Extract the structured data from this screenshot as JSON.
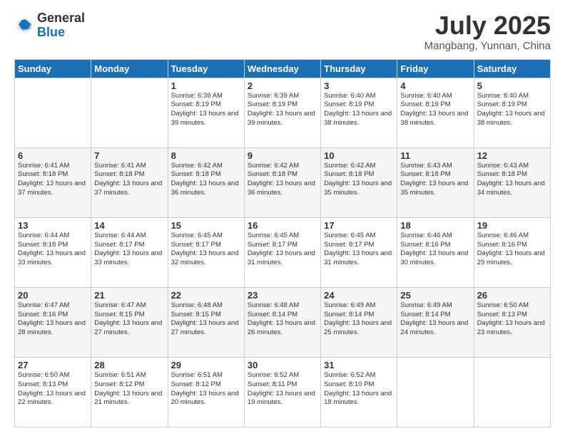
{
  "header": {
    "logo": {
      "general": "General",
      "blue": "Blue"
    },
    "title": "July 2025",
    "subtitle": "Mangbang, Yunnan, China"
  },
  "days_of_week": [
    "Sunday",
    "Monday",
    "Tuesday",
    "Wednesday",
    "Thursday",
    "Friday",
    "Saturday"
  ],
  "weeks": [
    [
      {
        "day": "",
        "info": ""
      },
      {
        "day": "",
        "info": ""
      },
      {
        "day": "1",
        "info": "Sunrise: 6:39 AM\nSunset: 8:19 PM\nDaylight: 13 hours and 39 minutes."
      },
      {
        "day": "2",
        "info": "Sunrise: 6:39 AM\nSunset: 8:19 PM\nDaylight: 13 hours and 39 minutes."
      },
      {
        "day": "3",
        "info": "Sunrise: 6:40 AM\nSunset: 8:19 PM\nDaylight: 13 hours and 38 minutes."
      },
      {
        "day": "4",
        "info": "Sunrise: 6:40 AM\nSunset: 8:19 PM\nDaylight: 13 hours and 38 minutes."
      },
      {
        "day": "5",
        "info": "Sunrise: 6:40 AM\nSunset: 8:19 PM\nDaylight: 13 hours and 38 minutes."
      }
    ],
    [
      {
        "day": "6",
        "info": "Sunrise: 6:41 AM\nSunset: 8:18 PM\nDaylight: 13 hours and 37 minutes."
      },
      {
        "day": "7",
        "info": "Sunrise: 6:41 AM\nSunset: 8:18 PM\nDaylight: 13 hours and 37 minutes."
      },
      {
        "day": "8",
        "info": "Sunrise: 6:42 AM\nSunset: 8:18 PM\nDaylight: 13 hours and 36 minutes."
      },
      {
        "day": "9",
        "info": "Sunrise: 6:42 AM\nSunset: 8:18 PM\nDaylight: 13 hours and 36 minutes."
      },
      {
        "day": "10",
        "info": "Sunrise: 6:42 AM\nSunset: 8:18 PM\nDaylight: 13 hours and 35 minutes."
      },
      {
        "day": "11",
        "info": "Sunrise: 6:43 AM\nSunset: 8:18 PM\nDaylight: 13 hours and 35 minutes."
      },
      {
        "day": "12",
        "info": "Sunrise: 6:43 AM\nSunset: 8:18 PM\nDaylight: 13 hours and 34 minutes."
      }
    ],
    [
      {
        "day": "13",
        "info": "Sunrise: 6:44 AM\nSunset: 8:18 PM\nDaylight: 13 hours and 33 minutes."
      },
      {
        "day": "14",
        "info": "Sunrise: 6:44 AM\nSunset: 8:17 PM\nDaylight: 13 hours and 33 minutes."
      },
      {
        "day": "15",
        "info": "Sunrise: 6:45 AM\nSunset: 8:17 PM\nDaylight: 13 hours and 32 minutes."
      },
      {
        "day": "16",
        "info": "Sunrise: 6:45 AM\nSunset: 8:17 PM\nDaylight: 13 hours and 31 minutes."
      },
      {
        "day": "17",
        "info": "Sunrise: 6:45 AM\nSunset: 8:17 PM\nDaylight: 13 hours and 31 minutes."
      },
      {
        "day": "18",
        "info": "Sunrise: 6:46 AM\nSunset: 8:16 PM\nDaylight: 13 hours and 30 minutes."
      },
      {
        "day": "19",
        "info": "Sunrise: 6:46 AM\nSunset: 8:16 PM\nDaylight: 13 hours and 29 minutes."
      }
    ],
    [
      {
        "day": "20",
        "info": "Sunrise: 6:47 AM\nSunset: 8:16 PM\nDaylight: 13 hours and 28 minutes."
      },
      {
        "day": "21",
        "info": "Sunrise: 6:47 AM\nSunset: 8:15 PM\nDaylight: 13 hours and 27 minutes."
      },
      {
        "day": "22",
        "info": "Sunrise: 6:48 AM\nSunset: 8:15 PM\nDaylight: 13 hours and 27 minutes."
      },
      {
        "day": "23",
        "info": "Sunrise: 6:48 AM\nSunset: 8:14 PM\nDaylight: 13 hours and 26 minutes."
      },
      {
        "day": "24",
        "info": "Sunrise: 6:49 AM\nSunset: 8:14 PM\nDaylight: 13 hours and 25 minutes."
      },
      {
        "day": "25",
        "info": "Sunrise: 6:49 AM\nSunset: 8:14 PM\nDaylight: 13 hours and 24 minutes."
      },
      {
        "day": "26",
        "info": "Sunrise: 6:50 AM\nSunset: 8:13 PM\nDaylight: 13 hours and 23 minutes."
      }
    ],
    [
      {
        "day": "27",
        "info": "Sunrise: 6:50 AM\nSunset: 8:13 PM\nDaylight: 13 hours and 22 minutes."
      },
      {
        "day": "28",
        "info": "Sunrise: 6:51 AM\nSunset: 8:12 PM\nDaylight: 13 hours and 21 minutes."
      },
      {
        "day": "29",
        "info": "Sunrise: 6:51 AM\nSunset: 8:12 PM\nDaylight: 13 hours and 20 minutes."
      },
      {
        "day": "30",
        "info": "Sunrise: 6:52 AM\nSunset: 8:11 PM\nDaylight: 13 hours and 19 minutes."
      },
      {
        "day": "31",
        "info": "Sunrise: 6:52 AM\nSunset: 8:10 PM\nDaylight: 13 hours and 18 minutes."
      },
      {
        "day": "",
        "info": ""
      },
      {
        "day": "",
        "info": ""
      }
    ]
  ]
}
